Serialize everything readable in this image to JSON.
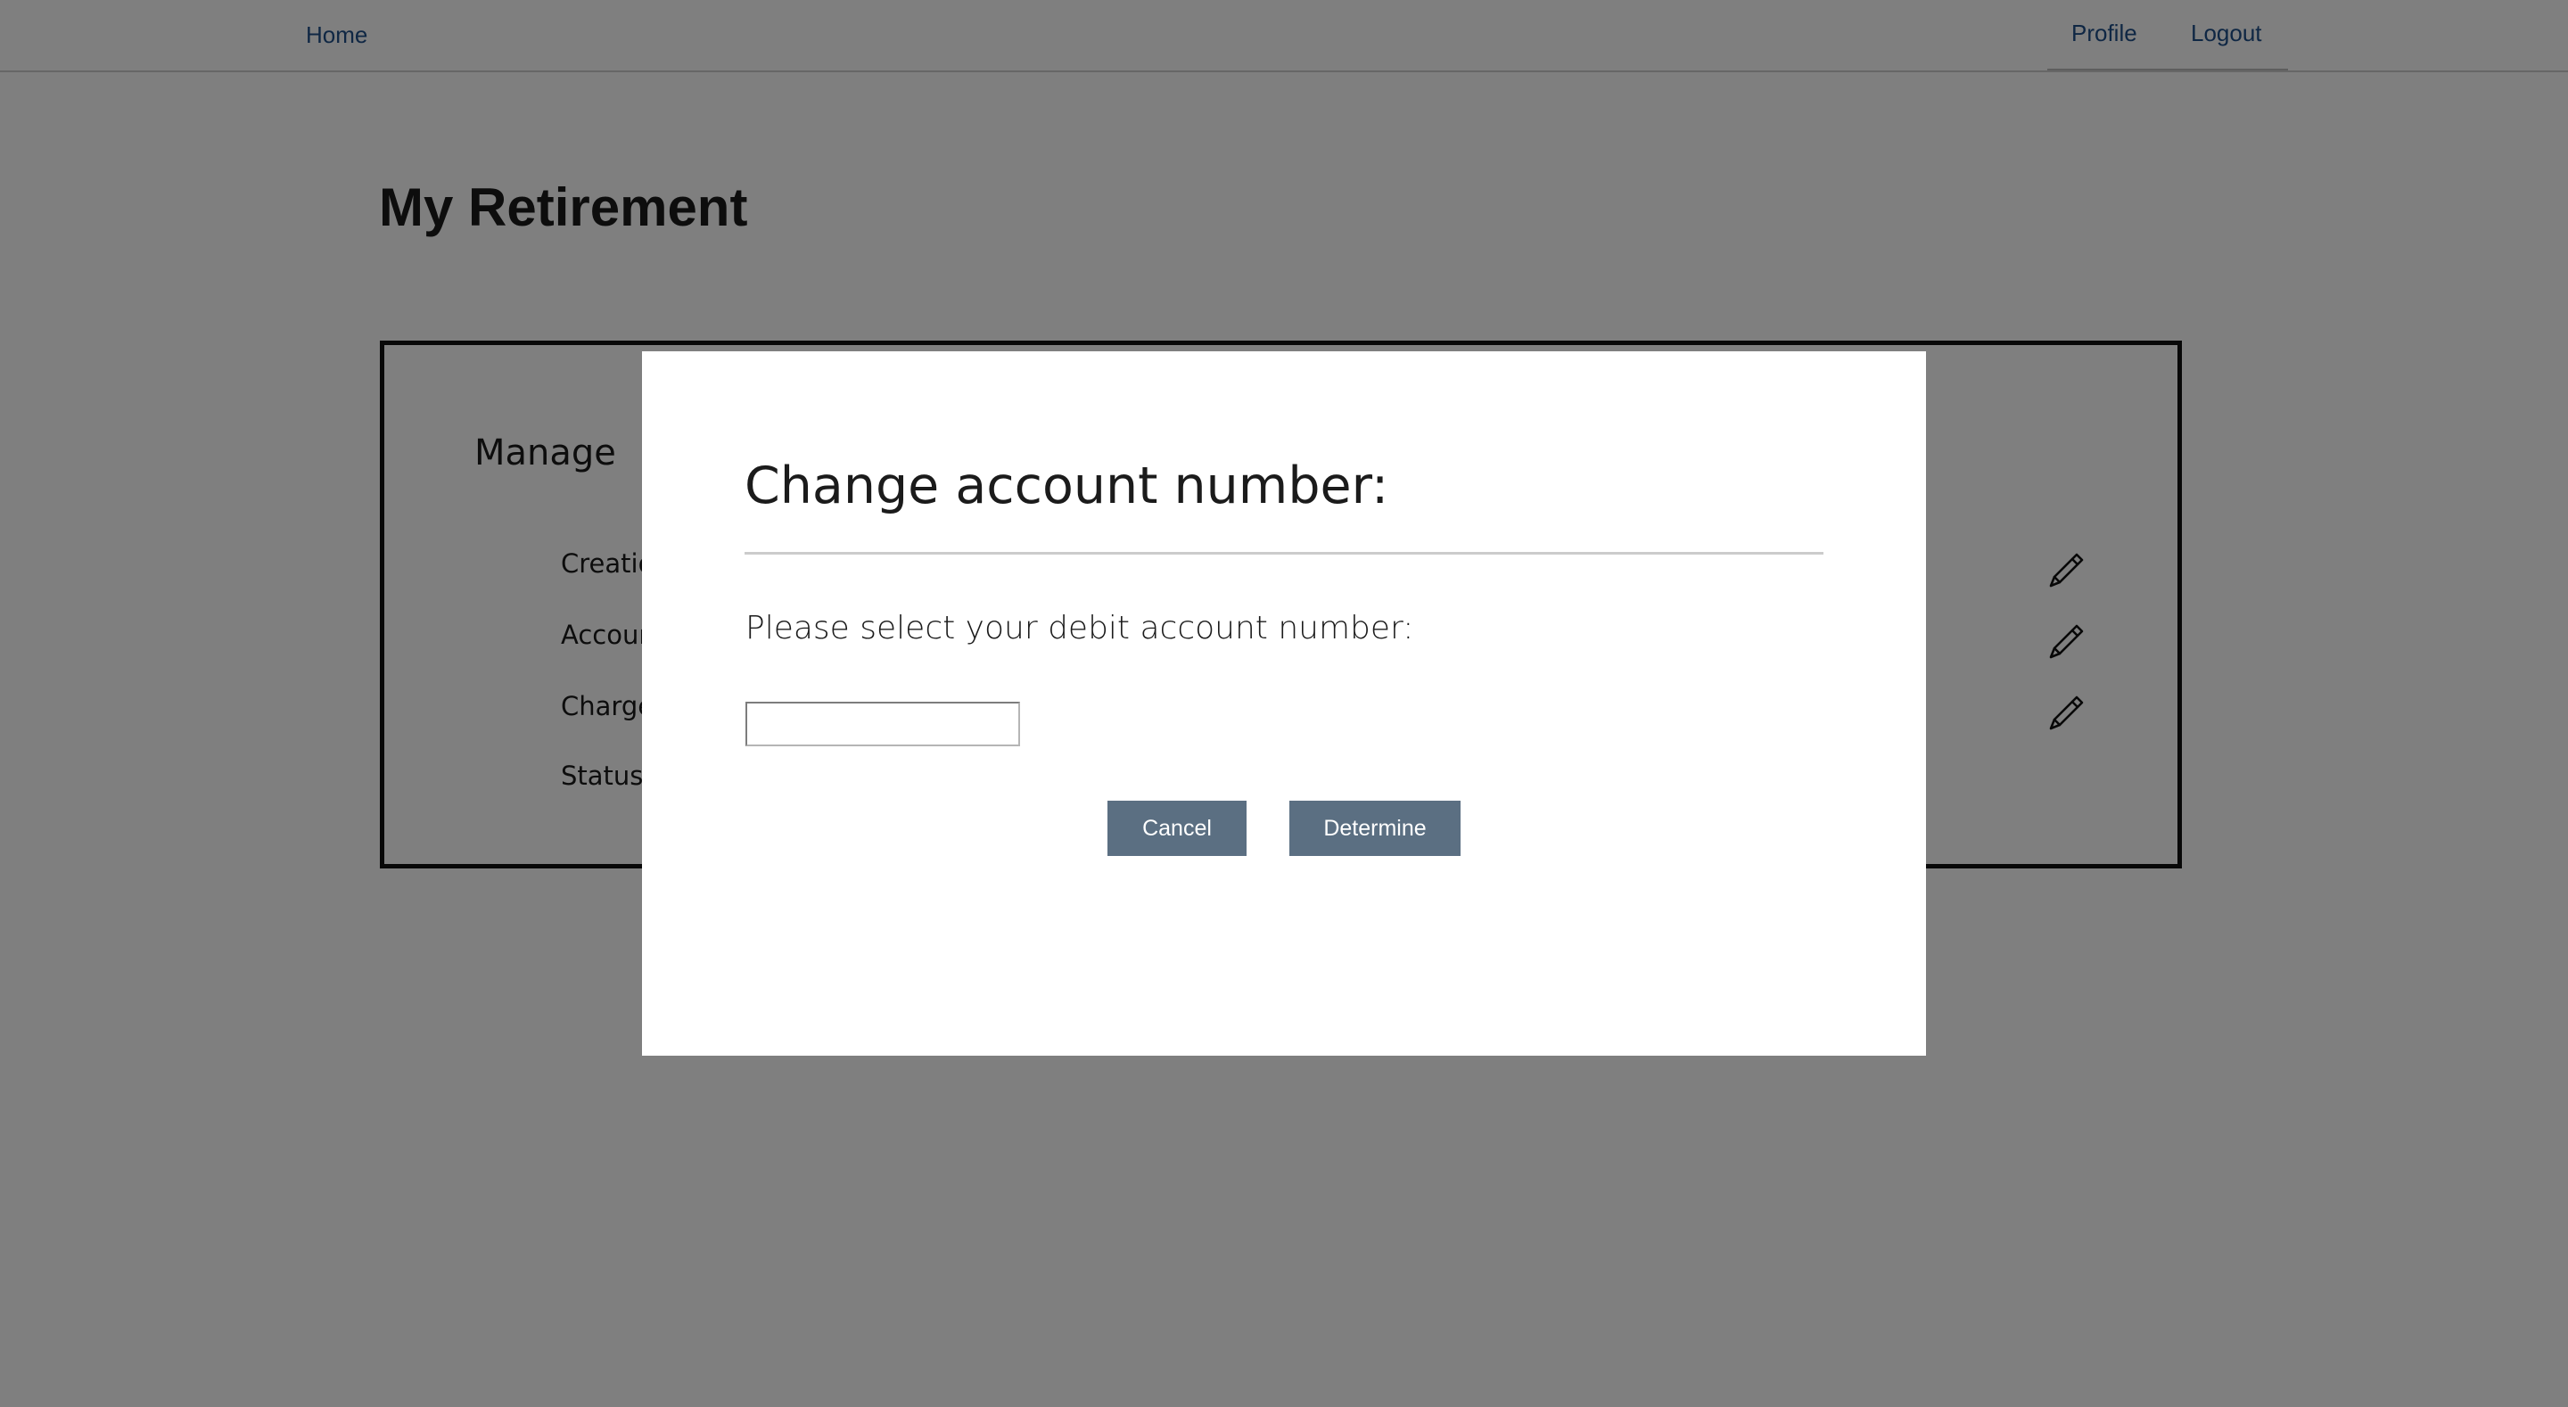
{
  "nav": {
    "home": "Home",
    "profile": "Profile",
    "logout": "Logout",
    "link_color": "#1f4e88"
  },
  "page": {
    "title": "My Retirement"
  },
  "manage": {
    "heading": "Manage",
    "rows": [
      {
        "label": "Creatio"
      },
      {
        "label": "Accour"
      },
      {
        "label": "Charge"
      },
      {
        "label": "Status:"
      }
    ],
    "edit_icon": "pencil-icon"
  },
  "modal": {
    "title": "Change account number:",
    "prompt": "Please select your debit account number:",
    "input_value": "",
    "cancel_label": "Cancel",
    "determine_label": "Determine",
    "button_color": "#5b6f82"
  }
}
